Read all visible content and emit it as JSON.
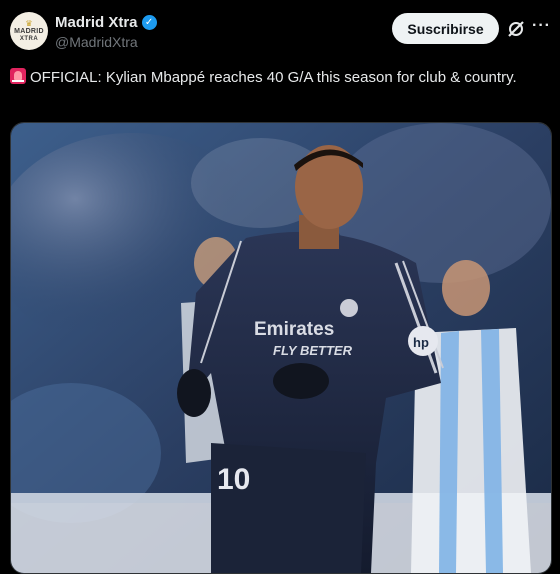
{
  "account": {
    "display_name": "Madrid Xtra",
    "handle": "@MadridXtra",
    "avatar_line1": "MADRID",
    "avatar_line2": "XTRA",
    "verified": true
  },
  "actions": {
    "subscribe_label": "Suscribirse",
    "grok_icon": "grok-icon",
    "more_icon": "more-icon"
  },
  "tweet": {
    "text": "OFFICIAL: Kylian Mbappé reaches 40 G/A this season for club & country.",
    "emoji": "siren-icon"
  },
  "media": {
    "description_icon": "photo",
    "shirt_text_line1": "Emirates",
    "shirt_text_line2": "FLY BETTER",
    "shirt_number": "10"
  },
  "colors": {
    "background": "#000000",
    "text": "#e7e9ea",
    "secondary": "#71767b",
    "verified": "#1d9bf0",
    "button": "#eff3f4",
    "kit_navy": "#1f2a44"
  }
}
